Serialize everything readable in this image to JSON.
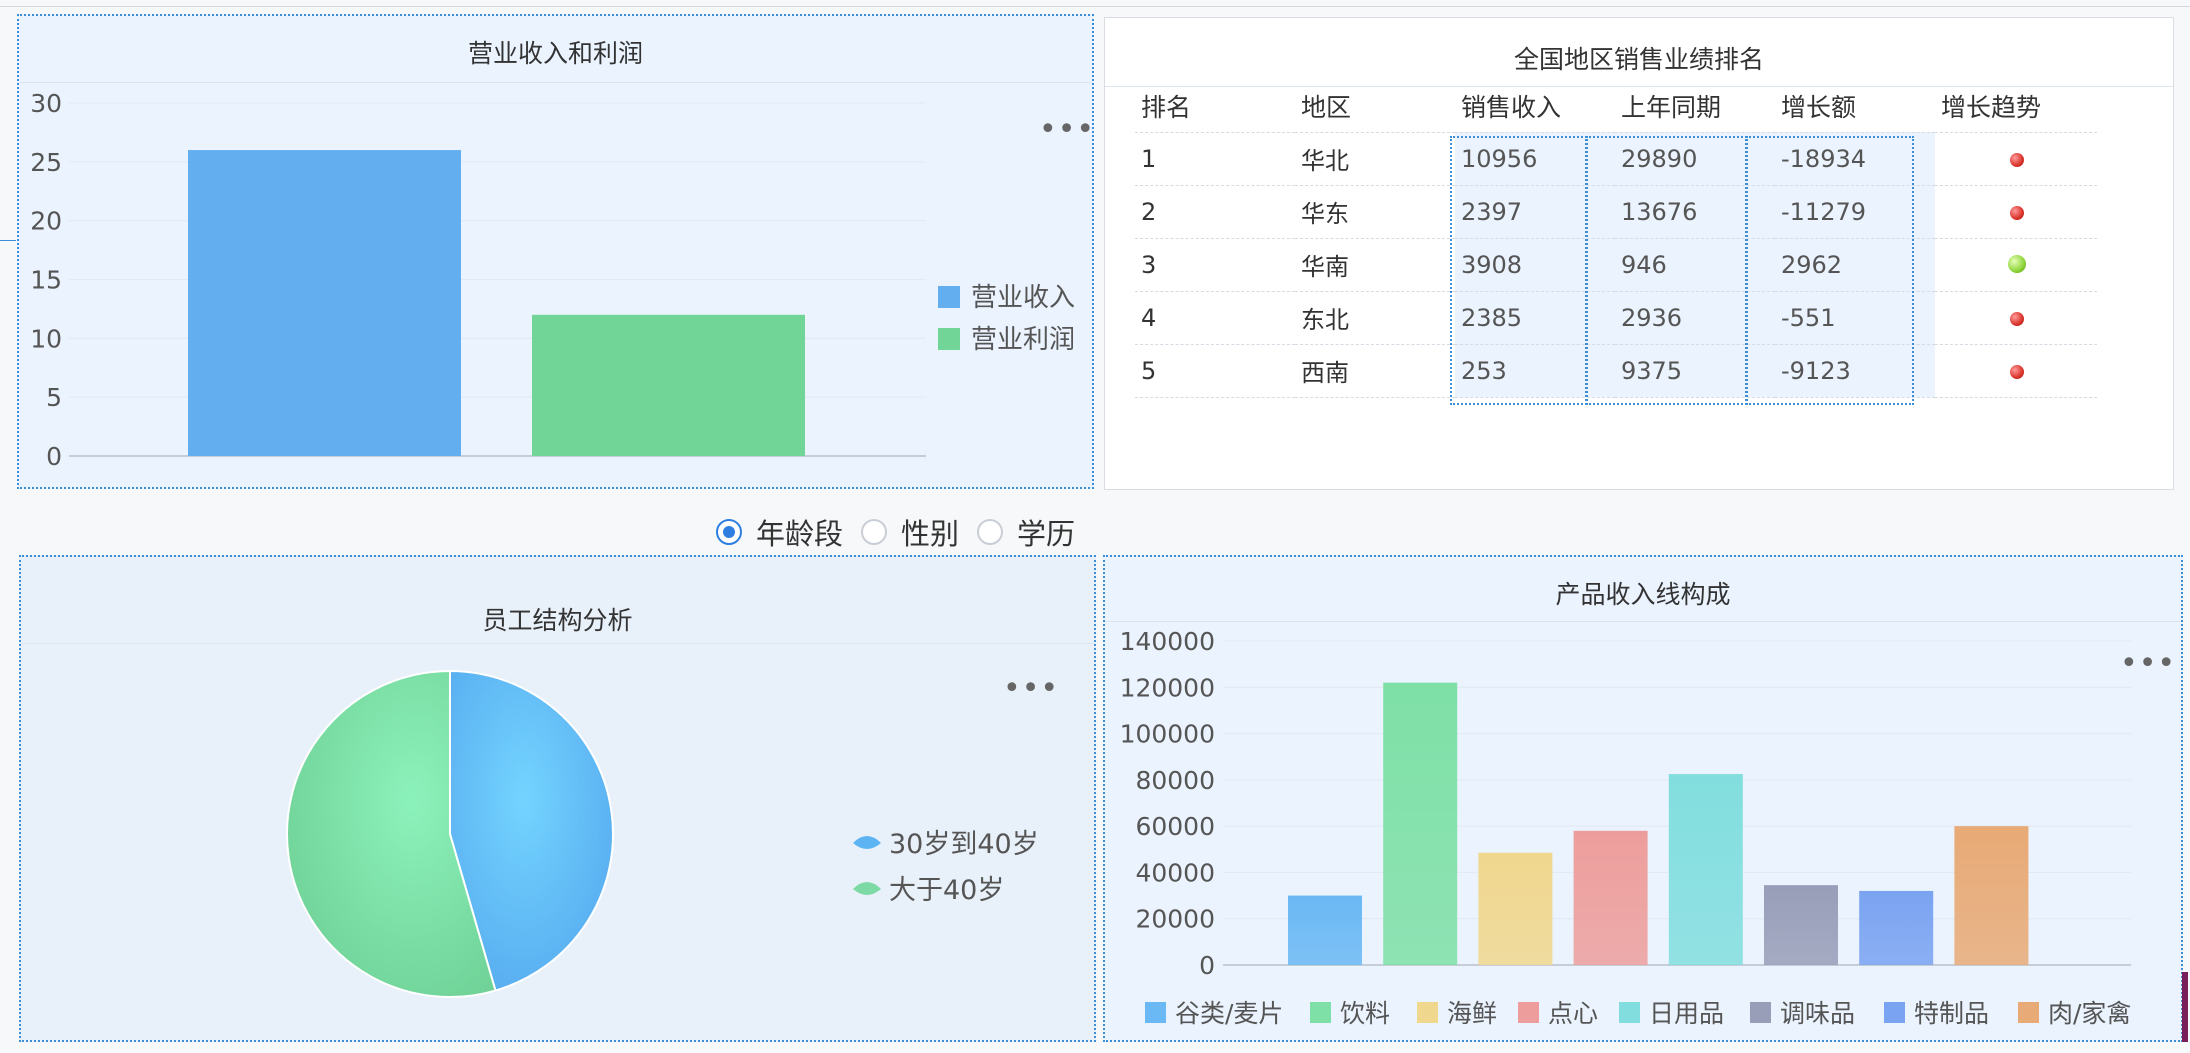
{
  "revenue_panel": {
    "title": "营业收入和利润",
    "more": "•••",
    "legend": [
      "营业收入",
      "营业利润"
    ],
    "colors": [
      "#62aeef",
      "#72d598"
    ]
  },
  "ranking_panel": {
    "title": "全国地区销售业绩排名",
    "headers": [
      "排名",
      "地区",
      "销售收入",
      "上年同期",
      "增长额",
      "增长趋势"
    ],
    "rows": [
      {
        "rank": "1",
        "region": "华北",
        "sales": "10956",
        "last_year": "29890",
        "growth": "-18934",
        "trend": "down"
      },
      {
        "rank": "2",
        "region": "华东",
        "sales": "2397",
        "last_year": "13676",
        "growth": "-11279",
        "trend": "down"
      },
      {
        "rank": "3",
        "region": "华南",
        "sales": "3908",
        "last_year": "946",
        "growth": "2962",
        "trend": "up"
      },
      {
        "rank": "4",
        "region": "东北",
        "sales": "2385",
        "last_year": "2936",
        "growth": "-551",
        "trend": "down"
      },
      {
        "rank": "5",
        "region": "西南",
        "sales": "253",
        "last_year": "9375",
        "growth": "-9123",
        "trend": "down"
      }
    ]
  },
  "filter": {
    "options": [
      "年龄段",
      "性别",
      "学历"
    ],
    "selected": "年龄段"
  },
  "staff_panel": {
    "title": "员工结构分析",
    "more": "•••"
  },
  "product_panel": {
    "title": "产品收入线构成",
    "more": "•••"
  },
  "chart_data": [
    {
      "type": "bar",
      "title": "营业收入和利润",
      "categories": [
        "营业收入",
        "营业利润"
      ],
      "values": [
        26,
        12
      ],
      "ylim": [
        0,
        30
      ],
      "yticks": [
        0,
        5,
        10,
        15,
        20,
        25,
        30
      ],
      "legend_position": "right",
      "grid": true
    },
    {
      "type": "pie",
      "title": "员工结构分析",
      "labels": [
        "30岁到40岁",
        "大于40岁"
      ],
      "values": [
        45.5,
        54.5
      ],
      "colors": [
        "#5cb4f2",
        "#7ddaa4"
      ],
      "legend_position": "right"
    },
    {
      "type": "bar",
      "title": "产品收入线构成",
      "categories": [
        "谷类/麦片",
        "饮料",
        "海鲜",
        "点心",
        "日用品",
        "调味品",
        "特制品",
        "肉/家禽"
      ],
      "values": [
        30000,
        122000,
        48500,
        58000,
        82500,
        34500,
        32000,
        60000
      ],
      "colors": [
        "#6ab8f4",
        "#7ee0a6",
        "#f0d78e",
        "#ed9e9c",
        "#82dede",
        "#989eb8",
        "#7aa3f1",
        "#e8aa76"
      ],
      "ylim": [
        0,
        140000
      ],
      "yticks": [
        0,
        20000,
        40000,
        60000,
        80000,
        100000,
        120000,
        140000
      ],
      "legend_position": "bottom",
      "grid": true
    }
  ]
}
